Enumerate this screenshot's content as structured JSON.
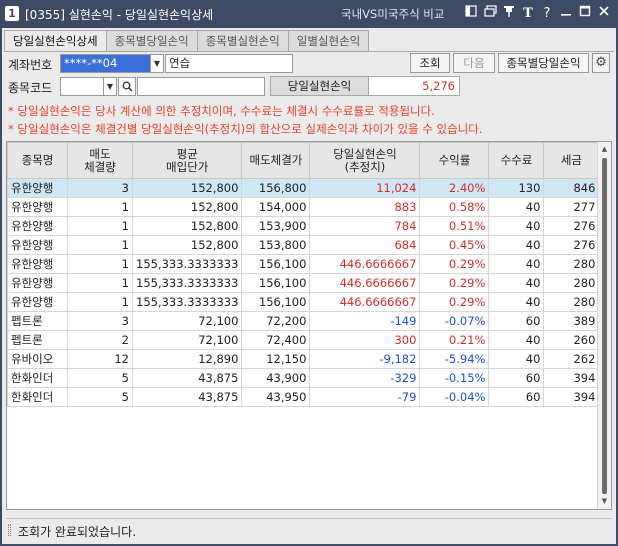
{
  "window": {
    "number": "1",
    "title": "[0355] 실현손익 - 당일실현손익상세",
    "compare_label": "국내VS미국주식 비교",
    "icons": [
      "restore-frame-icon",
      "window-icon",
      "pin-icon",
      "font-size-icon",
      "help-icon",
      "minimize-icon",
      "maximize-icon",
      "close-icon"
    ]
  },
  "tabs": [
    {
      "label": "당일실현손익상세",
      "active": true
    },
    {
      "label": "종목별당일손익",
      "active": false
    },
    {
      "label": "종목별실현손익",
      "active": false
    },
    {
      "label": "일별실현손익",
      "active": false
    }
  ],
  "form": {
    "account_label": "계좌번호",
    "account_value": "****-**04",
    "account_name": "연습",
    "stock_code_label": "종목코드",
    "stock_code_value": "",
    "stock_name_value": "",
    "query_button": "조회",
    "next_button": "다음",
    "by_stock_button": "종목별당일손익",
    "pnl_label": "당일실현손익",
    "pnl_value": "5,276"
  },
  "notes": [
    "* 당일실현손익은 당사 계산에 의한 추정치이며, 수수료는 체결시 수수료률로 적용됩니다.",
    "* 당일실현손익은 체결건별 당일실현손익(추정치)의 합산으로 실제손익과 차이가 있을 수 있습니다."
  ],
  "table": {
    "headers": [
      {
        "line1": "종목명",
        "line2": ""
      },
      {
        "line1": "매도",
        "line2": "체결량"
      },
      {
        "line1": "평균",
        "line2": "매입단가"
      },
      {
        "line1": "매도체결가",
        "line2": ""
      },
      {
        "line1": "당일실현손익",
        "line2": "(추정치)"
      },
      {
        "line1": "수익률",
        "line2": ""
      },
      {
        "line1": "수수료",
        "line2": ""
      },
      {
        "line1": "세금",
        "line2": ""
      }
    ],
    "rows": [
      {
        "name": "유한양행",
        "qty": "3",
        "avg": "152,800",
        "sell": "156,800",
        "pnl": "11,024",
        "rate": "2.40%",
        "fee": "130",
        "tax": "846",
        "sign": "pos"
      },
      {
        "name": "유한양행",
        "qty": "1",
        "avg": "152,800",
        "sell": "154,000",
        "pnl": "883",
        "rate": "0.58%",
        "fee": "40",
        "tax": "277",
        "sign": "pos"
      },
      {
        "name": "유한양행",
        "qty": "1",
        "avg": "152,800",
        "sell": "153,900",
        "pnl": "784",
        "rate": "0.51%",
        "fee": "40",
        "tax": "276",
        "sign": "pos"
      },
      {
        "name": "유한양행",
        "qty": "1",
        "avg": "152,800",
        "sell": "153,800",
        "pnl": "684",
        "rate": "0.45%",
        "fee": "40",
        "tax": "276",
        "sign": "pos"
      },
      {
        "name": "유한양행",
        "qty": "1",
        "avg": "155,333.3333333",
        "sell": "156,100",
        "pnl": "446.6666667",
        "rate": "0.29%",
        "fee": "40",
        "tax": "280",
        "sign": "pos"
      },
      {
        "name": "유한양행",
        "qty": "1",
        "avg": "155,333.3333333",
        "sell": "156,100",
        "pnl": "446.6666667",
        "rate": "0.29%",
        "fee": "40",
        "tax": "280",
        "sign": "pos"
      },
      {
        "name": "유한양행",
        "qty": "1",
        "avg": "155,333.3333333",
        "sell": "156,100",
        "pnl": "446.6666667",
        "rate": "0.29%",
        "fee": "40",
        "tax": "280",
        "sign": "pos"
      },
      {
        "name": "펩트론",
        "qty": "3",
        "avg": "72,100",
        "sell": "72,200",
        "pnl": "-149",
        "rate": "-0.07%",
        "fee": "60",
        "tax": "389",
        "sign": "neg"
      },
      {
        "name": "펩트론",
        "qty": "2",
        "avg": "72,100",
        "sell": "72,400",
        "pnl": "300",
        "rate": "0.21%",
        "fee": "40",
        "tax": "260",
        "sign": "pos"
      },
      {
        "name": "유바이오",
        "qty": "12",
        "avg": "12,890",
        "sell": "12,150",
        "pnl": "-9,182",
        "rate": "-5.94%",
        "fee": "40",
        "tax": "262",
        "sign": "neg"
      },
      {
        "name": "한화인더",
        "qty": "5",
        "avg": "43,875",
        "sell": "43,900",
        "pnl": "-329",
        "rate": "-0.15%",
        "fee": "60",
        "tax": "394",
        "sign": "neg"
      },
      {
        "name": "한화인더",
        "qty": "5",
        "avg": "43,875",
        "sell": "43,950",
        "pnl": "-79",
        "rate": "-0.04%",
        "fee": "60",
        "tax": "394",
        "sign": "neg"
      }
    ]
  },
  "status": {
    "message": "조회가 완료되었습니다."
  },
  "colors": {
    "titlebar": "#3c4b63",
    "positive": "#d42c2c",
    "negative": "#1f4fd6",
    "selected_row": "#cfe6f3",
    "notice": "#e8412b"
  }
}
